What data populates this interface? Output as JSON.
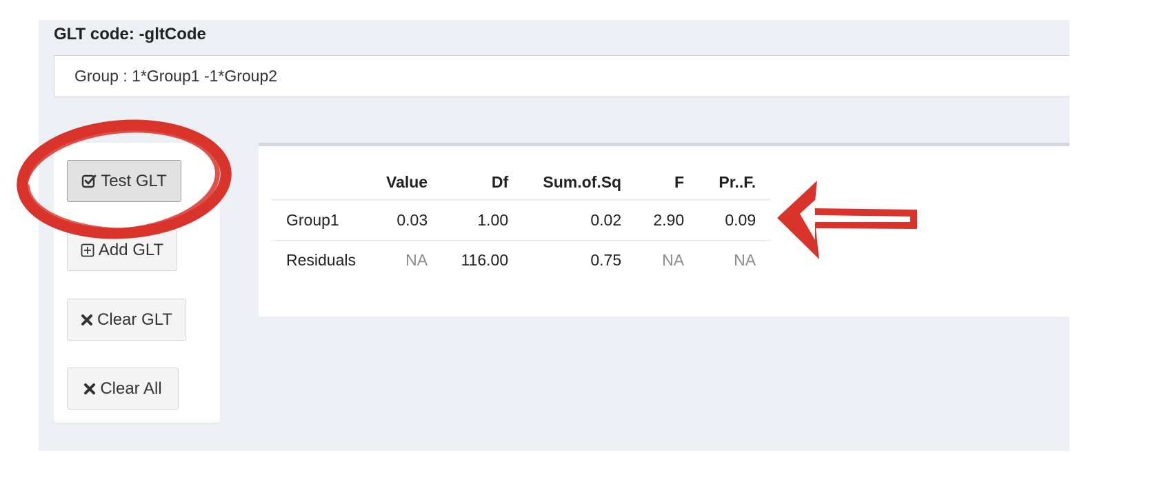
{
  "glt": {
    "label": "GLT code: -gltCode",
    "code_value": "Group : 1*Group1 -1*Group2"
  },
  "buttons": {
    "test": "Test GLT",
    "add": "Add GLT",
    "clear": "Clear GLT",
    "clear_all": "Clear All"
  },
  "results": {
    "headers": [
      "",
      "Value",
      "Df",
      "Sum.of.Sq",
      "F",
      "Pr..F."
    ],
    "rows": [
      {
        "name": "Group1",
        "cells": [
          "0.03",
          "1.00",
          "0.02",
          "2.90",
          "0.09"
        ]
      },
      {
        "name": "Residuals",
        "cells": [
          "NA",
          "116.00",
          "0.75",
          "NA",
          "NA"
        ]
      }
    ]
  },
  "colors": {
    "annotation_red": "#d9342b",
    "panel_background": "#ecf0f5",
    "na_text": "#8c8c8c"
  },
  "icons": {
    "test": "check-square-icon",
    "add": "plus-square-icon",
    "clear": "x-icon",
    "clear_all": "x-icon"
  }
}
